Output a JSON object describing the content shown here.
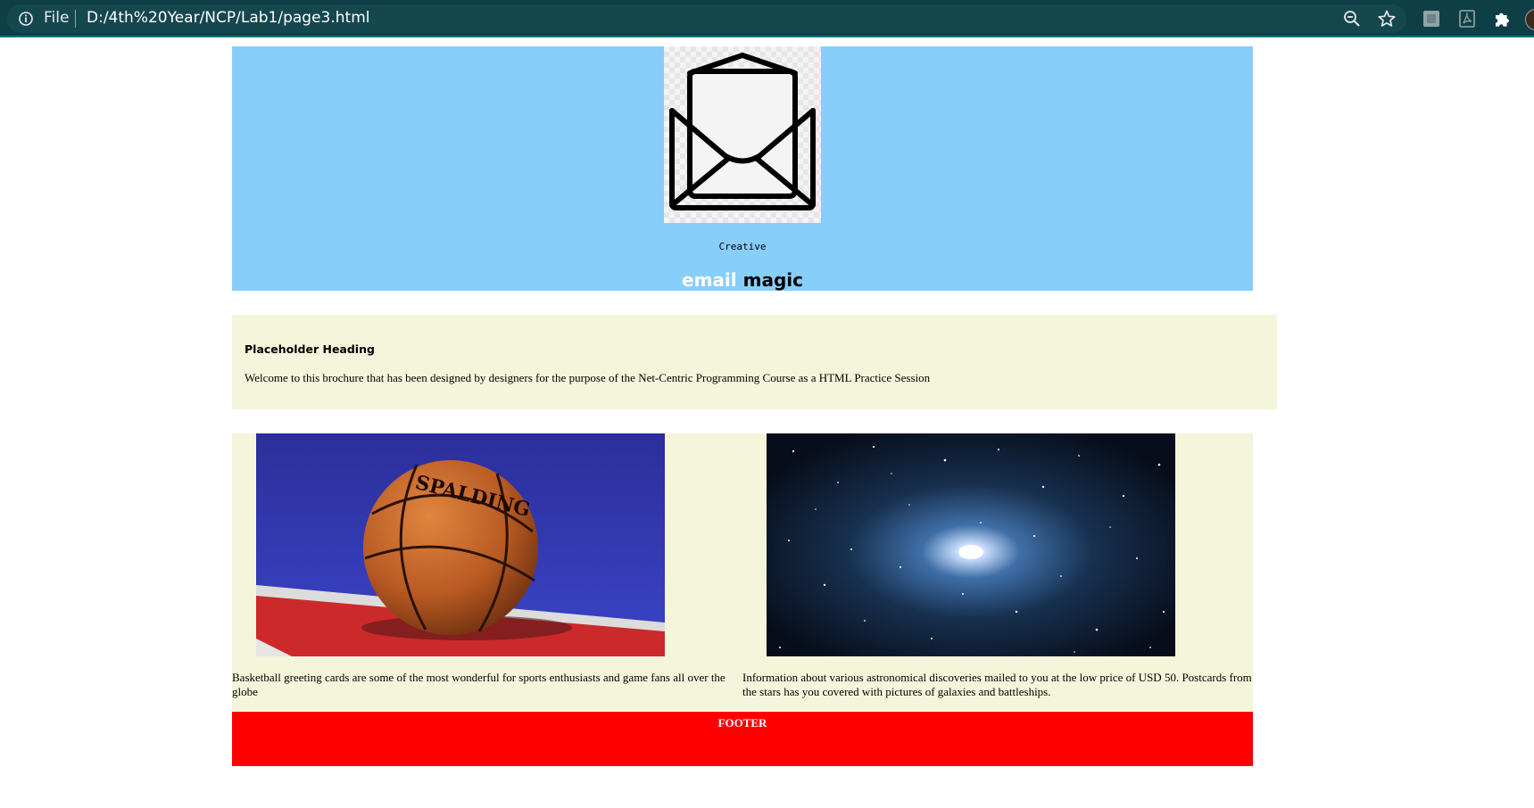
{
  "browser": {
    "scheme_label": "File",
    "url": "D:/4th%20Year/NCP/Lab1/page3.html",
    "toolbar_icons": [
      "zoom-out-icon",
      "bookmark-star-icon",
      "extension-icon",
      "pdf-extension-icon",
      "puzzle-extensions-icon",
      "profile-avatar"
    ]
  },
  "header": {
    "logo_icon": "open-envelope-icon",
    "tagline": "Creative",
    "brand_part1": "email",
    "brand_part2": "magic",
    "colors": {
      "background": "#87cefa",
      "brand_part1": "#ffffff",
      "brand_part2": "#000000"
    }
  },
  "intro": {
    "heading": "Placeholder Heading",
    "text": "Welcome to this brochure that has been designed by designers for the purpose of the Net-Centric Programming Course as a HTML Practice Session",
    "background": "#f5f5dc"
  },
  "cards": [
    {
      "image": "basketball-photo",
      "ball_text": "SPALDING",
      "caption": "Basketball greeting cards are some of the most wonderful for sports enthusiasts and game fans all over the globe"
    },
    {
      "image": "starfield-galaxy-photo",
      "caption": "Information about various astronomical discoveries mailed to you at the low price of USD 50. Postcards from the stars has you covered with pictures of galaxies and battleships."
    }
  ],
  "footer": {
    "text": "FOOTER",
    "background": "#ff0000"
  }
}
